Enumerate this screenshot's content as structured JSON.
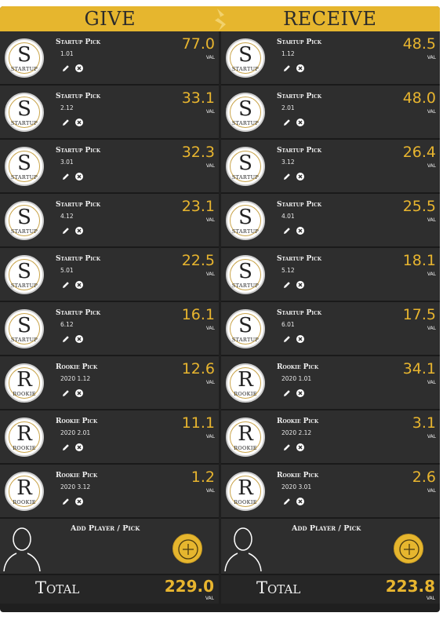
{
  "header": {
    "give": "GIVE",
    "receive": "RECEIVE"
  },
  "colors": {
    "accent": "#e6b62e",
    "value": "#e8b52f",
    "row_bg": "#2e2e2e"
  },
  "icons": {
    "edit": "pencil-icon",
    "remove": "remove-x-icon",
    "add": "plus-icon",
    "placeholder": "person-silhouette-icon",
    "swap": "lightning-bolt-icon"
  },
  "give": {
    "items": [
      {
        "type": "Startup Pick",
        "pick": "1.01",
        "value": "77.0",
        "unit": "VAL",
        "logo": {
          "letter": "S",
          "word": "STARTUP"
        }
      },
      {
        "type": "Startup Pick",
        "pick": "2.12",
        "value": "33.1",
        "unit": "VAL",
        "logo": {
          "letter": "S",
          "word": "STARTUP"
        }
      },
      {
        "type": "Startup Pick",
        "pick": "3.01",
        "value": "32.3",
        "unit": "VAL",
        "logo": {
          "letter": "S",
          "word": "STARTUP"
        }
      },
      {
        "type": "Startup Pick",
        "pick": "4.12",
        "value": "23.1",
        "unit": "VAL",
        "logo": {
          "letter": "S",
          "word": "STARTUP"
        }
      },
      {
        "type": "Startup Pick",
        "pick": "5.01",
        "value": "22.5",
        "unit": "VAL",
        "logo": {
          "letter": "S",
          "word": "STARTUP"
        }
      },
      {
        "type": "Startup Pick",
        "pick": "6.12",
        "value": "16.1",
        "unit": "VAL",
        "logo": {
          "letter": "S",
          "word": "STARTUP"
        }
      },
      {
        "type": "Rookie Pick",
        "pick": "2020 1.12",
        "value": "12.6",
        "unit": "VAL",
        "logo": {
          "letter": "R",
          "word": "ROOKIE"
        }
      },
      {
        "type": "Rookie Pick",
        "pick": "2020 2.01",
        "value": "11.1",
        "unit": "VAL",
        "logo": {
          "letter": "R",
          "word": "ROOKIE"
        }
      },
      {
        "type": "Rookie Pick",
        "pick": "2020 3.12",
        "value": "1.2",
        "unit": "VAL",
        "logo": {
          "letter": "R",
          "word": "ROOKIE"
        }
      }
    ],
    "add_label": "Add Player / Pick",
    "total_label": "Total",
    "total_value": "229.0",
    "total_unit": "VAL"
  },
  "receive": {
    "items": [
      {
        "type": "Startup Pick",
        "pick": "1.12",
        "value": "48.5",
        "unit": "VAL",
        "logo": {
          "letter": "S",
          "word": "STARTUP"
        }
      },
      {
        "type": "Startup Pick",
        "pick": "2.01",
        "value": "48.0",
        "unit": "VAL",
        "logo": {
          "letter": "S",
          "word": "STARTUP"
        }
      },
      {
        "type": "Startup Pick",
        "pick": "3.12",
        "value": "26.4",
        "unit": "VAL",
        "logo": {
          "letter": "S",
          "word": "STARTUP"
        }
      },
      {
        "type": "Startup Pick",
        "pick": "4.01",
        "value": "25.5",
        "unit": "VAL",
        "logo": {
          "letter": "S",
          "word": "STARTUP"
        }
      },
      {
        "type": "Startup Pick",
        "pick": "5.12",
        "value": "18.1",
        "unit": "VAL",
        "logo": {
          "letter": "S",
          "word": "STARTUP"
        }
      },
      {
        "type": "Startup Pick",
        "pick": "6.01",
        "value": "17.5",
        "unit": "VAL",
        "logo": {
          "letter": "S",
          "word": "STARTUP"
        }
      },
      {
        "type": "Rookie Pick",
        "pick": "2020 1.01",
        "value": "34.1",
        "unit": "VAL",
        "logo": {
          "letter": "R",
          "word": "ROOKIE"
        }
      },
      {
        "type": "Rookie Pick",
        "pick": "2020 2.12",
        "value": "3.1",
        "unit": "VAL",
        "logo": {
          "letter": "R",
          "word": "ROOKIE"
        }
      },
      {
        "type": "Rookie Pick",
        "pick": "2020 3.01",
        "value": "2.6",
        "unit": "VAL",
        "logo": {
          "letter": "R",
          "word": "ROOKIE"
        }
      }
    ],
    "add_label": "Add Player / Pick",
    "total_label": "Total",
    "total_value": "223.8",
    "total_unit": "VAL"
  }
}
